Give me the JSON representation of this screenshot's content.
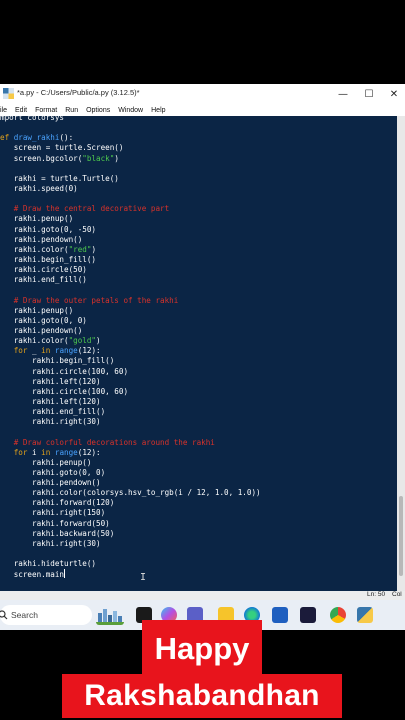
{
  "window": {
    "title": "*a.py - C:/Users/Public/a.py (3.12.5)*",
    "minimize": "—",
    "maximize": "☐",
    "close": "✕"
  },
  "menu": [
    "ile",
    "Edit",
    "Format",
    "Run",
    "Options",
    "Window",
    "Help"
  ],
  "code_lines": [
    [
      {
        "t": "mport colorsys",
        "c": ""
      }
    ],
    [
      {
        "t": "",
        "c": ""
      }
    ],
    [
      {
        "t": "ef ",
        "c": "kw"
      },
      {
        "t": "draw_rakhi",
        "c": "fn"
      },
      {
        "t": "():",
        "c": ""
      }
    ],
    [
      {
        "t": "   screen = turtle.Screen()",
        "c": ""
      }
    ],
    [
      {
        "t": "   screen.bgcolor(",
        "c": ""
      },
      {
        "t": "\"black\"",
        "c": "str"
      },
      {
        "t": ")",
        "c": ""
      }
    ],
    [
      {
        "t": "",
        "c": ""
      }
    ],
    [
      {
        "t": "   rakhi = turtle.Turtle()",
        "c": ""
      }
    ],
    [
      {
        "t": "   rakhi.speed(0)",
        "c": ""
      }
    ],
    [
      {
        "t": "",
        "c": ""
      }
    ],
    [
      {
        "t": "   # Draw the central decorative part",
        "c": "cm"
      }
    ],
    [
      {
        "t": "   rakhi.penup()",
        "c": ""
      }
    ],
    [
      {
        "t": "   rakhi.goto(0, -50)",
        "c": ""
      }
    ],
    [
      {
        "t": "   rakhi.pendown()",
        "c": ""
      }
    ],
    [
      {
        "t": "   rakhi.color(",
        "c": ""
      },
      {
        "t": "\"red\"",
        "c": "str"
      },
      {
        "t": ")",
        "c": ""
      }
    ],
    [
      {
        "t": "   rakhi.begin_fill()",
        "c": ""
      }
    ],
    [
      {
        "t": "   rakhi.circle(50)",
        "c": ""
      }
    ],
    [
      {
        "t": "   rakhi.end_fill()",
        "c": ""
      }
    ],
    [
      {
        "t": "",
        "c": ""
      }
    ],
    [
      {
        "t": "   # Draw the outer petals of the rakhi",
        "c": "cm"
      }
    ],
    [
      {
        "t": "   rakhi.penup()",
        "c": ""
      }
    ],
    [
      {
        "t": "   rakhi.goto(0, 0)",
        "c": ""
      }
    ],
    [
      {
        "t": "   rakhi.pendown()",
        "c": ""
      }
    ],
    [
      {
        "t": "   rakhi.color(",
        "c": ""
      },
      {
        "t": "\"gold\"",
        "c": "str"
      },
      {
        "t": ")",
        "c": ""
      }
    ],
    [
      {
        "t": "   ",
        "c": ""
      },
      {
        "t": "for",
        "c": "kw"
      },
      {
        "t": " _ ",
        "c": ""
      },
      {
        "t": "in",
        "c": "kw"
      },
      {
        "t": " ",
        "c": ""
      },
      {
        "t": "range",
        "c": "fn"
      },
      {
        "t": "(12):",
        "c": ""
      }
    ],
    [
      {
        "t": "       rakhi.begin_fill()",
        "c": ""
      }
    ],
    [
      {
        "t": "       rakhi.circle(100, 60)",
        "c": ""
      }
    ],
    [
      {
        "t": "       rakhi.left(120)",
        "c": ""
      }
    ],
    [
      {
        "t": "       rakhi.circle(100, 60)",
        "c": ""
      }
    ],
    [
      {
        "t": "       rakhi.left(120)",
        "c": ""
      }
    ],
    [
      {
        "t": "       rakhi.end_fill()",
        "c": ""
      }
    ],
    [
      {
        "t": "       rakhi.right(30)",
        "c": ""
      }
    ],
    [
      {
        "t": "",
        "c": ""
      }
    ],
    [
      {
        "t": "   # Draw colorful decorations around the rakhi",
        "c": "cm"
      }
    ],
    [
      {
        "t": "   ",
        "c": ""
      },
      {
        "t": "for",
        "c": "kw"
      },
      {
        "t": " i ",
        "c": ""
      },
      {
        "t": "in",
        "c": "kw"
      },
      {
        "t": " ",
        "c": ""
      },
      {
        "t": "range",
        "c": "fn"
      },
      {
        "t": "(12):",
        "c": ""
      }
    ],
    [
      {
        "t": "       rakhi.penup()",
        "c": ""
      }
    ],
    [
      {
        "t": "       rakhi.goto(0, 0)",
        "c": ""
      }
    ],
    [
      {
        "t": "       rakhi.pendown()",
        "c": ""
      }
    ],
    [
      {
        "t": "       rakhi.color(colorsys.hsv_to_rgb(i / 12, 1.0, 1.0))",
        "c": ""
      }
    ],
    [
      {
        "t": "       rakhi.forward(120)",
        "c": ""
      }
    ],
    [
      {
        "t": "       rakhi.right(150)",
        "c": ""
      }
    ],
    [
      {
        "t": "       rakhi.forward(50)",
        "c": ""
      }
    ],
    [
      {
        "t": "       rakhi.backward(50)",
        "c": ""
      }
    ],
    [
      {
        "t": "       rakhi.right(30)",
        "c": ""
      }
    ],
    [
      {
        "t": "",
        "c": ""
      }
    ],
    [
      {
        "t": "   rakhi.hideturtle()",
        "c": ""
      }
    ],
    [
      {
        "t": "   screen.main",
        "c": ""
      }
    ]
  ],
  "status": {
    "ln": "Ln: 50",
    "col": "Col"
  },
  "taskbar": {
    "search_placeholder": "Search"
  },
  "banner": {
    "line1": "Happy",
    "line2": "Rakshabandhan"
  },
  "colors": {
    "editor_bg": "#0b2545",
    "keyword": "#e3a21a",
    "builtin": "#4aa3ff",
    "string": "#4ec94e",
    "comment": "#d9322a",
    "banner": "#e8141c"
  }
}
